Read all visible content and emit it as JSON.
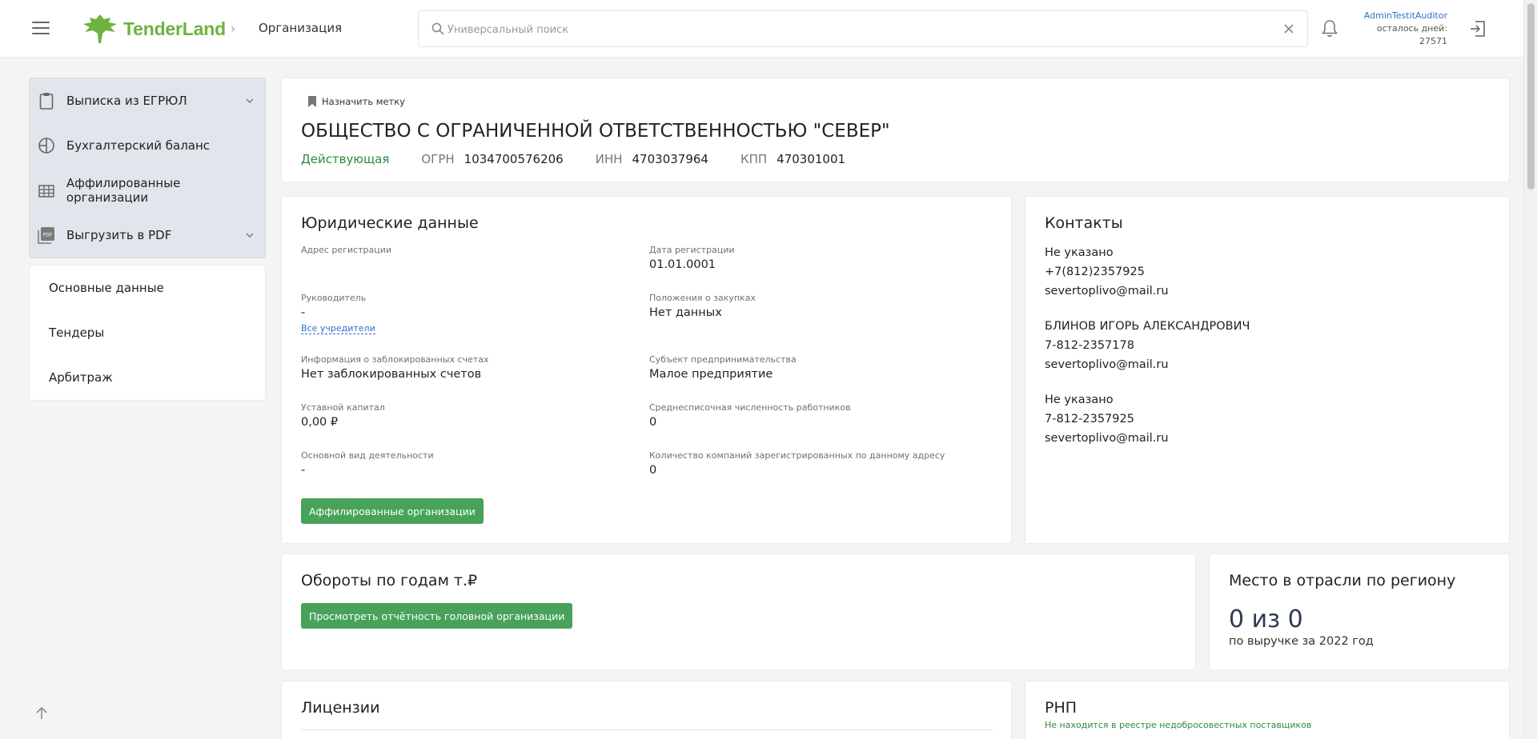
{
  "header": {
    "logo_text": "TenderLand",
    "breadcrumb": "Организация",
    "search_placeholder": "Универсальный поиск",
    "user_name": "AdminTestitAuditor",
    "days_label": "осталось дней:",
    "days_value": "27571"
  },
  "sidebar": {
    "menu": [
      {
        "label": "Выписка из ЕГРЮЛ",
        "icon": "clipboard-icon"
      },
      {
        "label": "Бухгалтерский баланс",
        "icon": "pie-chart-icon"
      },
      {
        "label": "Аффилированные организации",
        "icon": "building-icon"
      },
      {
        "label": "Выгрузить в PDF",
        "icon": "pdf-icon",
        "pdf_badge": "PDF"
      }
    ],
    "nav": [
      {
        "label": "Основные данные"
      },
      {
        "label": "Тендеры"
      },
      {
        "label": "Арбитраж"
      }
    ]
  },
  "org": {
    "mark_label": "Назначить метку",
    "name": "ОБЩЕСТВО С ОГРАНИЧЕННОЙ ОТВЕТСТВЕННОСТЬЮ \"СЕВЕР\"",
    "status": "Действующая",
    "ogrn_label": "ОГРН",
    "ogrn": "1034700576206",
    "inn_label": "ИНН",
    "inn": "4703037964",
    "kpp_label": "КПП",
    "kpp": "470301001"
  },
  "legal": {
    "title": "Юридические данные",
    "address_label": "Адрес регистрации",
    "address_value": "",
    "reg_date_label": "Дата регистрации",
    "reg_date": "01.01.0001",
    "head_label": "Руководитель",
    "head_value": "-",
    "founders_link": "Все учредители",
    "procurement_label": "Положения о закупках",
    "procurement_value": "Нет данных",
    "blocked_label": "Информация о заблокированных счетах",
    "blocked_value": "Нет заблокированных счетов",
    "subject_label": "Субъект предпринимательства",
    "subject_value": "Малое предприятие",
    "capital_label": "Уставной капитал",
    "capital_value": "0,00 ₽",
    "employees_label": "Среднесписочная численность работников",
    "employees_value": "0",
    "activity_label": "Основной вид деятельности",
    "activity_value": "-",
    "companies_label": "Количество компаний зарегистрированных по данному адресу",
    "companies_value": "0",
    "affiliated_button": "Аффилированные организации"
  },
  "contacts": {
    "title": "Контакты",
    "entries": [
      {
        "name": "Не указано",
        "phone": "+7(812)2357925",
        "email": "severtoplivo@mail.ru"
      },
      {
        "name": "БЛИНОВ ИГОРЬ АЛЕКСАНДРОВИЧ",
        "phone": "7-812-2357178",
        "email": "severtoplivo@mail.ru"
      },
      {
        "name": "Не указано",
        "phone": "7-812-2357925",
        "email": "severtoplivo@mail.ru"
      }
    ]
  },
  "turnover": {
    "title": "Обороты по годам т.₽",
    "button": "Просмотреть отчётность головной организации"
  },
  "place": {
    "title": "Место в отрасли по региону",
    "value": "0 из 0",
    "subtitle": "по выручке за 2022 год"
  },
  "licenses": {
    "title": "Лицензии"
  },
  "rnp": {
    "title": "РНП",
    "status": "Не находится в реестре недобросовестных поставщиков"
  },
  "colors": {
    "brand_green": "#6cb33f",
    "button_green": "#48a25a",
    "status_green": "#2e8b3e",
    "link_blue": "#2f6fc8",
    "sidebar_active_bg": "#e1e5ec"
  }
}
